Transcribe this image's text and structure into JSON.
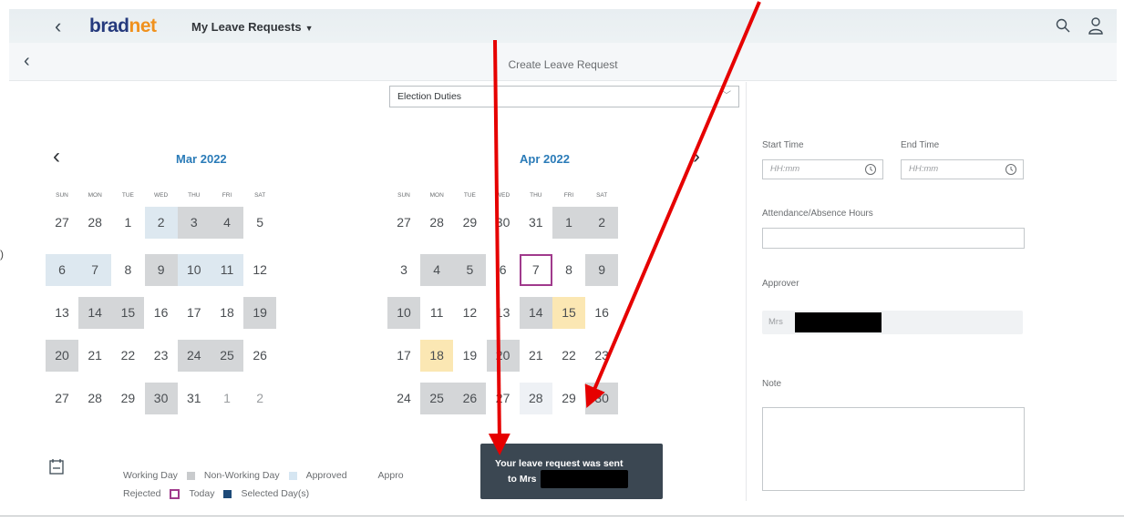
{
  "shell": {
    "brand_prefix": "brad",
    "brand_suffix": "net",
    "app_title": "My Leave Requests",
    "icons": [
      "back-icon",
      "search-icon",
      "user-icon"
    ]
  },
  "page": {
    "title": "Create Leave Request"
  },
  "leave_type": {
    "value": "Election Duties"
  },
  "calendar": {
    "weekdays": [
      "SUN",
      "MON",
      "TUE",
      "WED",
      "THU",
      "FRI",
      "SAT"
    ],
    "months": [
      {
        "label": "Mar 2022",
        "weeks": [
          [
            {
              "d": "27",
              "s": "normal"
            },
            {
              "d": "28",
              "s": "normal"
            },
            {
              "d": "1",
              "s": "normal"
            },
            {
              "d": "2",
              "s": "approved"
            },
            {
              "d": "3",
              "s": "nonworking"
            },
            {
              "d": "4",
              "s": "nonworking"
            },
            {
              "d": "5",
              "s": "normal"
            }
          ],
          [
            {
              "d": "6",
              "s": "approved"
            },
            {
              "d": "7",
              "s": "approved"
            },
            {
              "d": "8",
              "s": "normal"
            },
            {
              "d": "9",
              "s": "nonworking"
            },
            {
              "d": "10",
              "s": "approved"
            },
            {
              "d": "11",
              "s": "approved"
            },
            {
              "d": "12",
              "s": "normal"
            }
          ],
          [
            {
              "d": "13",
              "s": "normal"
            },
            {
              "d": "14",
              "s": "nonworking"
            },
            {
              "d": "15",
              "s": "nonworking"
            },
            {
              "d": "16",
              "s": "normal"
            },
            {
              "d": "17",
              "s": "normal"
            },
            {
              "d": "18",
              "s": "normal"
            },
            {
              "d": "19",
              "s": "nonworking"
            }
          ],
          [
            {
              "d": "20",
              "s": "nonworking"
            },
            {
              "d": "21",
              "s": "normal"
            },
            {
              "d": "22",
              "s": "normal"
            },
            {
              "d": "23",
              "s": "normal"
            },
            {
              "d": "24",
              "s": "nonworking"
            },
            {
              "d": "25",
              "s": "nonworking"
            },
            {
              "d": "26",
              "s": "normal"
            }
          ],
          [
            {
              "d": "27",
              "s": "normal"
            },
            {
              "d": "28",
              "s": "normal"
            },
            {
              "d": "29",
              "s": "normal"
            },
            {
              "d": "30",
              "s": "nonworking"
            },
            {
              "d": "31",
              "s": "normal"
            },
            {
              "d": "1",
              "s": "other"
            },
            {
              "d": "2",
              "s": "other"
            }
          ]
        ]
      },
      {
        "label": "Apr 2022",
        "weeks": [
          [
            {
              "d": "27",
              "s": "normal"
            },
            {
              "d": "28",
              "s": "normal"
            },
            {
              "d": "29",
              "s": "normal"
            },
            {
              "d": "30",
              "s": "normal"
            },
            {
              "d": "31",
              "s": "normal"
            },
            {
              "d": "1",
              "s": "nonworking"
            },
            {
              "d": "2",
              "s": "nonworking"
            }
          ],
          [
            {
              "d": "3",
              "s": "normal"
            },
            {
              "d": "4",
              "s": "nonworking"
            },
            {
              "d": "5",
              "s": "nonworking"
            },
            {
              "d": "6",
              "s": "normal"
            },
            {
              "d": "7",
              "s": "today"
            },
            {
              "d": "8",
              "s": "normal"
            },
            {
              "d": "9",
              "s": "nonworking"
            }
          ],
          [
            {
              "d": "10",
              "s": "nonworking"
            },
            {
              "d": "11",
              "s": "normal"
            },
            {
              "d": "12",
              "s": "normal"
            },
            {
              "d": "13",
              "s": "normal"
            },
            {
              "d": "14",
              "s": "nonworking"
            },
            {
              "d": "15",
              "s": "sent"
            },
            {
              "d": "16",
              "s": "normal"
            }
          ],
          [
            {
              "d": "17",
              "s": "normal"
            },
            {
              "d": "18",
              "s": "sent"
            },
            {
              "d": "19",
              "s": "normal"
            },
            {
              "d": "20",
              "s": "nonworking"
            },
            {
              "d": "21",
              "s": "normal"
            },
            {
              "d": "22",
              "s": "normal"
            },
            {
              "d": "23",
              "s": "normal"
            }
          ],
          [
            {
              "d": "24",
              "s": "normal"
            },
            {
              "d": "25",
              "s": "nonworking"
            },
            {
              "d": "26",
              "s": "nonworking"
            },
            {
              "d": "27",
              "s": "normal"
            },
            {
              "d": "28",
              "s": "pending"
            },
            {
              "d": "29",
              "s": "normal"
            },
            {
              "d": "30",
              "s": "nonworking"
            }
          ]
        ]
      }
    ]
  },
  "legend": {
    "working_day": "Working Day",
    "non_working_day": "Non-Working Day",
    "approved": "Approved",
    "appro_partial": "Appro",
    "rejected": "Rejected",
    "today": "Today",
    "selected": "Selected Day(s)"
  },
  "form": {
    "start_time_label": "Start Time",
    "end_time_label": "End Time",
    "time_placeholder": "HH:mm",
    "hours_label": "Attendance/Absence Hours",
    "approver_label": "Approver",
    "approver_prefix": "Mrs",
    "note_label": "Note"
  },
  "toast": {
    "line1": "Your leave request was sent",
    "line2": "to Mrs"
  },
  "colors": {
    "brand": "#253a7d",
    "brand_accent": "#f0911d",
    "month": "#2a7bb8",
    "today_border": "#a03a8c",
    "annotation_arrow": "#e60000"
  }
}
